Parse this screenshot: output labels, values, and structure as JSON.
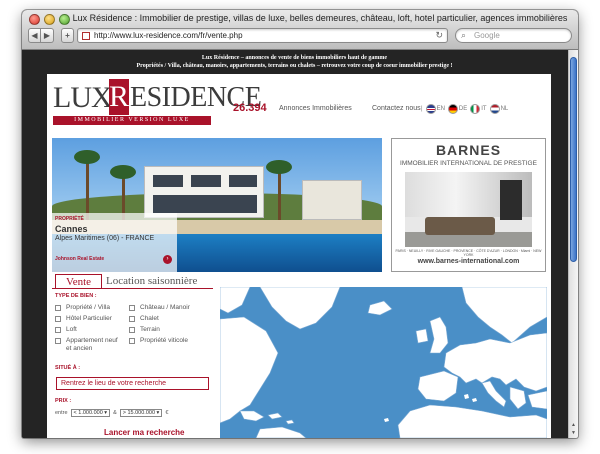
{
  "browser": {
    "window_title": "Lux Résidence : Immobilier de prestige, villas de luxe, belles demeures, château, loft, hotel particulier, agences immobilières",
    "url": "http://www.lux-residence.com/fr/vente.php",
    "search_placeholder": "Google"
  },
  "banner": {
    "line1": "Lux Résidence – annonces de vente de biens immobiliers haut de gamme",
    "line2": "Propriétés / Villa, château, manoirs, appartements, terrains ou chalets – retrouvez votre coup de coeur immobilier prestige !"
  },
  "header": {
    "logo_lux": "LUX",
    "logo_r": "R",
    "logo_esidence": "ESIDENCE",
    "logo_tagline": "IMMOBILIER VERSION LUXE",
    "count": "26.394",
    "count_label": "Annonces Immobilières",
    "contact": "Contactez nous",
    "languages": [
      {
        "code": "EN",
        "flag": "uk-flag"
      },
      {
        "code": "DE",
        "flag": "de-flag"
      },
      {
        "code": "IT",
        "flag": "it-flag"
      },
      {
        "code": "NL",
        "flag": "nl-flag"
      }
    ]
  },
  "hero": {
    "type": "PROPRIÉTÉ",
    "city": "Cannes",
    "region": "Alpes Maritimes (06) - FRANCE",
    "agency": "Johnson Real Estate"
  },
  "ad": {
    "title": "BARNES",
    "subtitle": "IMMOBILIER INTERNATIONAL DE PRESTIGE",
    "cities": "PARIS · NEUILLY · RIVE GAUCHE · PROVENCE · CÔTE D'AZUR · LONDON · Miami · NEW YORK",
    "url": "www.barnes-international.com"
  },
  "tabs": [
    {
      "label": "Vente",
      "active": true
    },
    {
      "label": "Location saisonnière",
      "active": false
    }
  ],
  "form": {
    "type_label": "TYPE DE BIEN :",
    "types_left": [
      "Propriété / Villa",
      "Hôtel Particulier",
      "Loft",
      "Appartement neuf et ancien"
    ],
    "types_right": [
      "Château / Manoir",
      "Chalet",
      "Terrain",
      "Propriété viticole"
    ],
    "location_label": "SITUÉ À :",
    "location_value": "Rentrez le lieu de votre recherche",
    "price_label": "PRIX :",
    "price_between": "entre",
    "price_min": "< 1.000.000",
    "price_and": "&",
    "price_max": "> 15.000.000",
    "currency": "€",
    "search_button": "Lancer ma recherche"
  },
  "colors": {
    "brand": "#a9122a",
    "map_sea": "#4a8fc7",
    "map_land": "#ffffff"
  }
}
